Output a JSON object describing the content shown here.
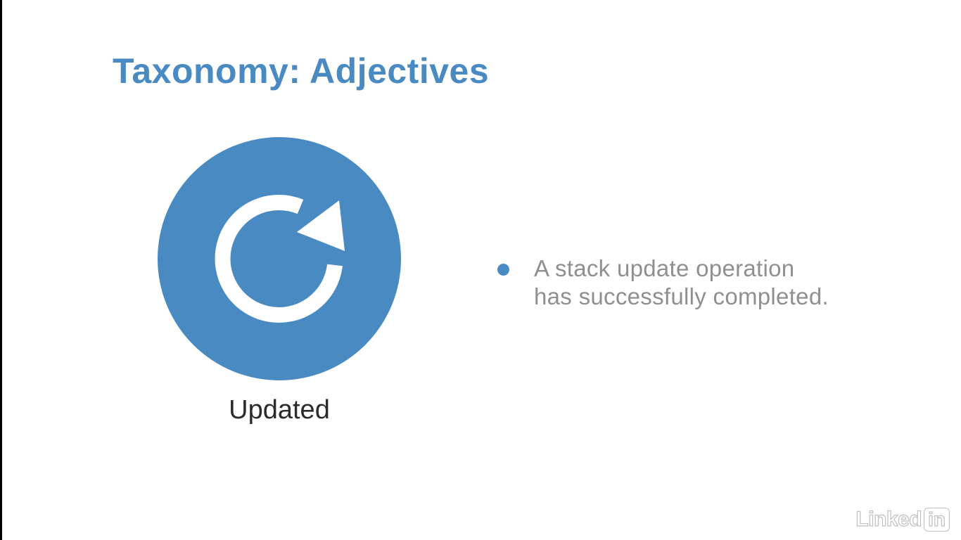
{
  "slide": {
    "title": "Taxonomy: Adjectives",
    "status": {
      "label": "Updated",
      "icon": "refresh-icon",
      "color": "#4a8ac2"
    },
    "bullets": [
      {
        "lines": [
          "A stack update operation",
          "has successfully completed."
        ]
      }
    ]
  },
  "watermark": {
    "brand_text": "Linked",
    "brand_box": "in"
  }
}
